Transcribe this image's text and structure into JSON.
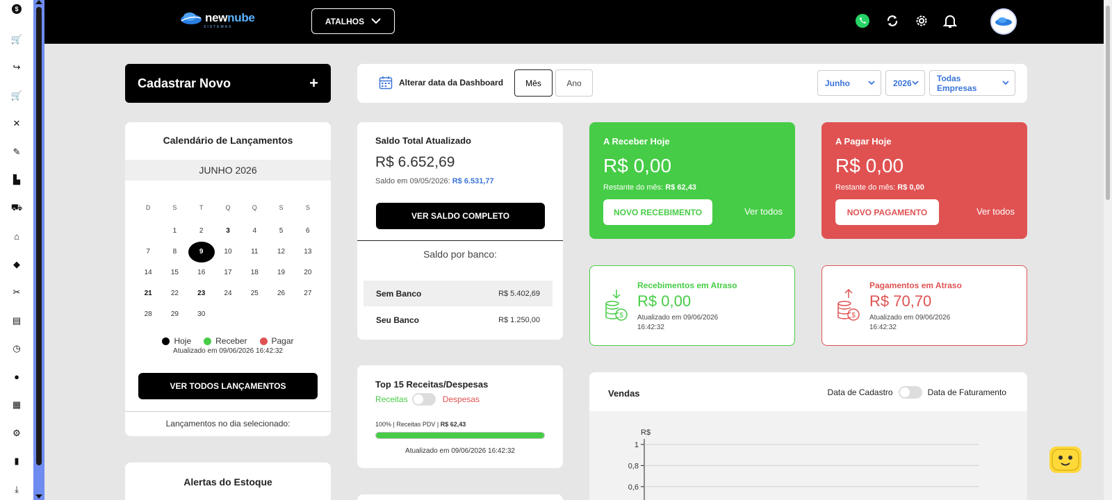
{
  "rail": {
    "icons": [
      "dollar-icon",
      "cart-icon",
      "share-icon",
      "cart-add-icon",
      "tools-icon",
      "edit-icon",
      "sitemap-icon",
      "truck-icon",
      "bank-icon",
      "car-icon",
      "wrench-icon",
      "receipt-icon",
      "clock-icon",
      "users-icon",
      "report-icon",
      "gear-icon",
      "chart-icon",
      "download-icon"
    ]
  },
  "header": {
    "logo_main": "new",
    "logo_accent": "nube",
    "logo_sub": "SISTEMAS",
    "atalhos_label": "ATALHOS",
    "icons": [
      "whatsapp-icon",
      "refresh-icon",
      "settings-icon",
      "bell-icon"
    ]
  },
  "cadastrar": {
    "label": "Cadastrar Novo",
    "plus": "+"
  },
  "calendar": {
    "title": "Calendário de Lançamentos",
    "month": "JUNHO 2026",
    "weekdays": [
      "D",
      "S",
      "T",
      "Q",
      "Q",
      "S",
      "S"
    ],
    "weeks": [
      [
        "",
        "1",
        "2",
        "3",
        "4",
        "5",
        "6"
      ],
      [
        "7",
        "8",
        "9",
        "10",
        "11",
        "12",
        "13"
      ],
      [
        "14",
        "15",
        "16",
        "17",
        "18",
        "19",
        "20"
      ],
      [
        "21",
        "22",
        "23",
        "24",
        "25",
        "26",
        "27"
      ],
      [
        "28",
        "29",
        "30",
        "",
        "",
        "",
        ""
      ]
    ],
    "today": "9",
    "bold_days": [
      "3",
      "21",
      "23"
    ],
    "dot_days": {
      "3": "pagar",
      "21": "receber",
      "23": "receber"
    },
    "legend": {
      "hoje": "Hoje",
      "receber": "Receber",
      "pagar": "Pagar"
    },
    "updated": "Atualizado em 09/06/2026 16:42:32",
    "ver_todos": "VER TODOS LANÇAMENTOS",
    "footer": "Lançamentos no dia selecionado:"
  },
  "alertas": {
    "title": "Alertas do Estoque"
  },
  "datebar": {
    "label": "Alterar data da Dashboard",
    "mes": "Mês",
    "ano": "Ano",
    "month_select": "Junho",
    "year_select": "2026",
    "company_select": "Todas Empresas"
  },
  "saldo": {
    "title": "Saldo Total Atualizado",
    "amount": "R$ 6.652,69",
    "sub_prefix": "Saldo em 09/05/2026:",
    "sub_value": "R$ 6.531,77",
    "button": "VER SALDO COMPLETO",
    "por_banco": "Saldo por banco:",
    "banks": [
      {
        "name": "Sem Banco",
        "value": "R$ 5.402,69"
      },
      {
        "name": "Seu Banco",
        "value": "R$ 1.250,00"
      }
    ]
  },
  "receber_hoje": {
    "title": "A Receber Hoje",
    "amount": "R$ 0,00",
    "rest_prefix": "Restante do mês:",
    "rest_value": "R$ 62,43",
    "button": "NOVO RECEBIMENTO",
    "ver_todos": "Ver todos"
  },
  "pagar_hoje": {
    "title": "A Pagar Hoje",
    "amount": "R$ 0,00",
    "rest_prefix": "Restante do mês:",
    "rest_value": "R$ 0,00",
    "button": "NOVO PAGAMENTO",
    "ver_todos": "Ver todos"
  },
  "rec_atraso": {
    "title": "Recebimentos em Atraso",
    "amount": "R$ 0,00",
    "updated": "Atualizado em 09/06/2026 16:42:32"
  },
  "pag_atraso": {
    "title": "Pagamentos em Atraso",
    "amount": "R$ 70,70",
    "updated": "Atualizado em 09/06/2026 16:42:32"
  },
  "top15": {
    "title": "Top 15 Receitas/Despesas",
    "receitas": "Receitas",
    "despesas": "Despesas",
    "line_prefix": "100% | Receitas PDV |",
    "line_value": "R$ 62,43",
    "progress": 1.0,
    "updated": "Atualizado em 09/06/2026 16:42:32"
  },
  "vendas": {
    "title": "Vendas",
    "data_cadastro": "Data de Cadastro",
    "data_faturamento": "Data de Faturamento"
  },
  "chart_data": {
    "type": "line",
    "ylabel": "R$",
    "y_ticks": [
      "1",
      "0,8",
      "0,6"
    ],
    "ylim": [
      0,
      1
    ],
    "series": []
  },
  "colors": {
    "green": "#46cc46",
    "red": "#e05252",
    "blue": "#3a73d8",
    "black": "#000000"
  }
}
